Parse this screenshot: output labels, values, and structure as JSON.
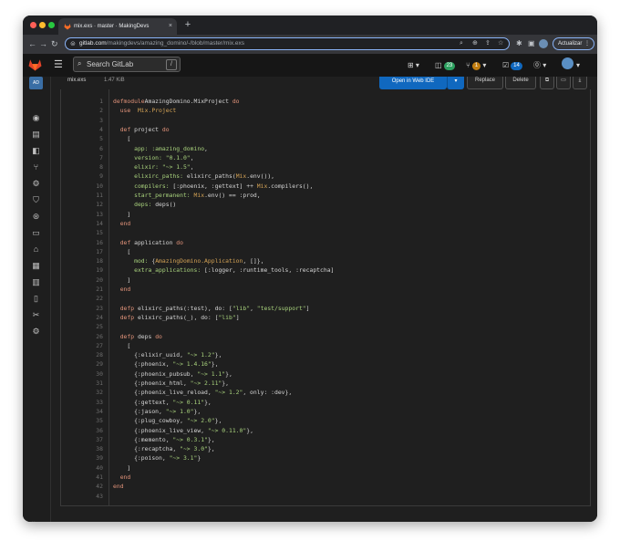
{
  "browser": {
    "tab_title": "mix.exs · master · MakingDevs",
    "tab_close": "×",
    "new_tab": "+",
    "url_domain": "gitlab.com",
    "url_path": "/makingdevs/amazing_domino/-/blob/master/mix.exs",
    "update_label": "Actualizar",
    "traffic_colors": [
      "#ff5f57",
      "#febc2e",
      "#28c840"
    ]
  },
  "header": {
    "search_placeholder": "Search GitLab",
    "search_shortcut": "/",
    "issues_count": "23",
    "mr_count": "1",
    "todo_count": "14"
  },
  "project": {
    "avatar_text": "AD"
  },
  "file": {
    "name": "mix.exs",
    "size": "1.47 KiB",
    "open_ide_label": "Open in Web IDE",
    "replace_label": "Replace",
    "delete_label": "Delete"
  },
  "code": {
    "lines": [
      [
        [
          "kw",
          "defmodule"
        ],
        [
          "",
          "AmazingDomino.MixProject "
        ],
        [
          "kw",
          "do"
        ]
      ],
      [
        [
          "",
          "  "
        ],
        [
          "kw",
          "use"
        ],
        [
          "",
          "  "
        ],
        [
          "mod",
          "Mix.Project"
        ]
      ],
      [],
      [
        [
          "",
          "  "
        ],
        [
          "kw",
          "def"
        ],
        [
          "",
          " project "
        ],
        [
          "kw",
          "do"
        ]
      ],
      [
        [
          "",
          "    ["
        ]
      ],
      [
        [
          "",
          "      "
        ],
        [
          "str",
          "app: :amazing_domino"
        ],
        [
          "",
          ","
        ]
      ],
      [
        [
          "",
          "      "
        ],
        [
          "str",
          "version: \"0.1.0\""
        ],
        [
          "",
          ","
        ]
      ],
      [
        [
          "",
          "      "
        ],
        [
          "str",
          "elixir: \"~> 1.5\""
        ],
        [
          "",
          ","
        ]
      ],
      [
        [
          "",
          "      "
        ],
        [
          "str",
          "elixirc_paths:"
        ],
        [
          "",
          " elixirc_paths("
        ],
        [
          "mod",
          "Mix"
        ],
        [
          "",
          ".env()),"
        ]
      ],
      [
        [
          "",
          "      "
        ],
        [
          "str",
          "compilers:"
        ],
        [
          "",
          " [:phoenix, :gettext] ++ "
        ],
        [
          "mod",
          "Mix"
        ],
        [
          "",
          ".compilers(),"
        ]
      ],
      [
        [
          "",
          "      "
        ],
        [
          "str",
          "start_permanent:"
        ],
        [
          "",
          "",
          " "
        ],
        [
          "mod",
          "Mix"
        ],
        [
          "",
          ".env() == :prod,"
        ]
      ],
      [
        [
          "",
          "      "
        ],
        [
          "str",
          "deps:"
        ],
        [
          "",
          " deps()"
        ]
      ],
      [
        [
          "",
          "    ]"
        ]
      ],
      [
        [
          "",
          "  "
        ],
        [
          "kw",
          "end"
        ]
      ],
      [],
      [
        [
          "",
          "  "
        ],
        [
          "kw",
          "def"
        ],
        [
          "",
          " application "
        ],
        [
          "kw",
          "do"
        ]
      ],
      [
        [
          "",
          "    ["
        ]
      ],
      [
        [
          "",
          "      "
        ],
        [
          "str",
          "mod:"
        ],
        [
          "",
          " {"
        ],
        [
          "mod",
          "AmazingDomino.Application"
        ],
        [
          "",
          ", []},"
        ]
      ],
      [
        [
          "",
          "      "
        ],
        [
          "str",
          "extra_applications:"
        ],
        [
          "",
          " [:logger, :runtime_tools, :recaptcha]"
        ]
      ],
      [
        [
          "",
          "    ]"
        ]
      ],
      [
        [
          "",
          "  "
        ],
        [
          "kw",
          "end"
        ]
      ],
      [],
      [
        [
          "",
          "  "
        ],
        [
          "kw",
          "defp"
        ],
        [
          "",
          " elixirc_paths(:test), do: ["
        ],
        [
          "str",
          "\"lib\""
        ],
        [
          "",
          ", "
        ],
        [
          "str",
          "\"test/support\""
        ],
        [
          "",
          "]"
        ]
      ],
      [
        [
          "",
          "  "
        ],
        [
          "kw",
          "defp"
        ],
        [
          "",
          " elixirc_paths(_), do: ["
        ],
        [
          "str",
          "\"lib\""
        ],
        [
          "",
          "]"
        ]
      ],
      [],
      [
        [
          "",
          "  "
        ],
        [
          "kw",
          "defp"
        ],
        [
          "",
          " deps "
        ],
        [
          "kw",
          "do"
        ]
      ],
      [
        [
          "",
          "    ["
        ]
      ],
      [
        [
          "",
          "      {:elixir_uuid, "
        ],
        [
          "str",
          "\"~> 1.2\""
        ],
        [
          "",
          "},"
        ]
      ],
      [
        [
          "",
          "      {:phoenix, "
        ],
        [
          "str",
          "\"~> 1.4.16\""
        ],
        [
          "",
          "},"
        ]
      ],
      [
        [
          "",
          "      {:phoenix_pubsub, "
        ],
        [
          "str",
          "\"~> 1.1\""
        ],
        [
          "",
          "},"
        ]
      ],
      [
        [
          "",
          "      {:phoenix_html, "
        ],
        [
          "str",
          "\"~> 2.11\""
        ],
        [
          "",
          "},"
        ]
      ],
      [
        [
          "",
          "      {:phoenix_live_reload, "
        ],
        [
          "str",
          "\"~> 1.2\""
        ],
        [
          "",
          ", only: :dev},"
        ]
      ],
      [
        [
          "",
          "      {:gettext, "
        ],
        [
          "str",
          "\"~> 0.11\""
        ],
        [
          "",
          "},"
        ]
      ],
      [
        [
          "",
          "      {:jason, "
        ],
        [
          "str",
          "\"~> 1.0\""
        ],
        [
          "",
          "},"
        ]
      ],
      [
        [
          "",
          "      {:plug_cowboy, "
        ],
        [
          "str",
          "\"~> 2.0\""
        ],
        [
          "",
          "},"
        ]
      ],
      [
        [
          "",
          "      {:phoenix_live_view, "
        ],
        [
          "str",
          "\"~> 0.11.0\""
        ],
        [
          "",
          "},"
        ]
      ],
      [
        [
          "",
          "      {:memento, "
        ],
        [
          "str",
          "\"~> 0.3.1\""
        ],
        [
          "",
          "},"
        ]
      ],
      [
        [
          "",
          "      {:recaptcha, "
        ],
        [
          "str",
          "\"~> 3.0\""
        ],
        [
          "",
          "},"
        ]
      ],
      [
        [
          "",
          "      {:poison, "
        ],
        [
          "str",
          "\"~> 3.1\""
        ],
        [
          "",
          "}"
        ]
      ],
      [
        [
          "",
          "    ]"
        ]
      ],
      [
        [
          "",
          "  "
        ],
        [
          "kw",
          "end"
        ]
      ],
      [
        [
          "kw",
          "end"
        ]
      ],
      []
    ]
  },
  "colors": {
    "primary_button": "#1068bf",
    "issues_badge": "#2da160",
    "mr_badge": "#c17d10",
    "todo_badge": "#1068bf"
  }
}
